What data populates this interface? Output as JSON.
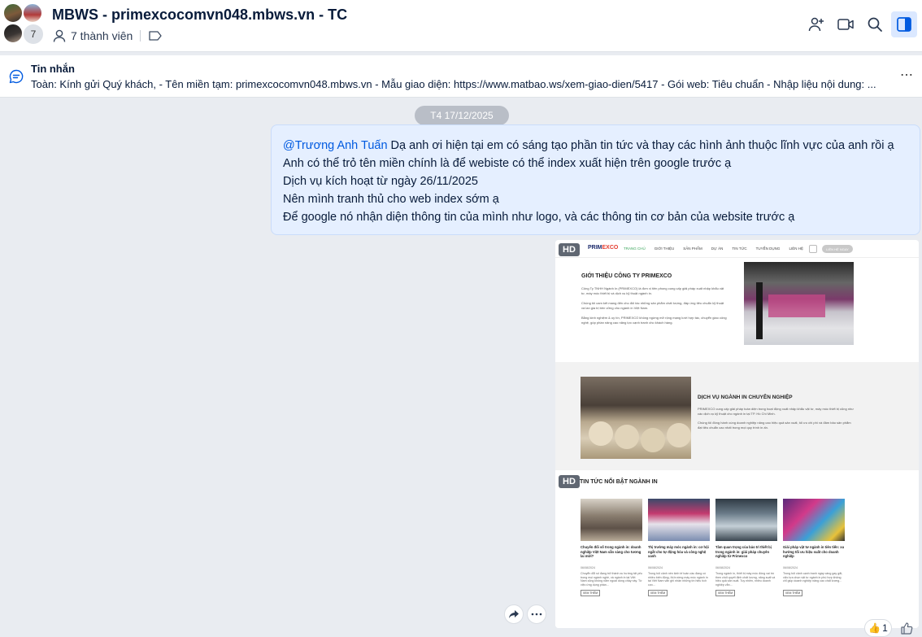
{
  "header": {
    "title": "MBWS - primexcocomvn048.mbws.vn - TC",
    "member_count_badge": "7",
    "members_label": "7 thành viên"
  },
  "pinned": {
    "title": "Tin nhắn",
    "text": "Toàn: Kính gửi Quý khách, - Tên miền tạm: primexcocomvn048.mbws.vn - Mẫu giao diện: https://www.matbao.ws/xem-giao-dien/5417 - Gói web: Tiêu chuẩn - Nhập liệu nội dung: ..."
  },
  "date_separator": "T4 17/12/2025",
  "message": {
    "mention": "@Trương Anh Tuấn",
    "line1": " Dạ anh ơi hiện tại em có sáng tạo phần tin tức và thay các hình ảnh thuộc lĩnh vực của anh rồi ạ",
    "line2": "Anh có thể trỏ tên miền chính là để webiste có thể index xuất hiện trên google trước ạ",
    "line3": "Dịch vụ kích hoạt từ ngày 26/11/2025",
    "line4": "Nên mình tranh thủ cho web index sớm ạ",
    "line5": "Để google nó nhận diện thông tin của mình như logo, và các thông tin cơ bản của website trước ạ"
  },
  "image_message": {
    "hd_label": "HD",
    "site": {
      "logo_main": "PRIM",
      "logo_accent": "EXCO",
      "menu": [
        "TRANG CHỦ",
        "GIỚI THIỆU",
        "SẢN PHẨM",
        "DỰ ÁN",
        "TIN TỨC",
        "TUYỂN DỤNG",
        "LIÊN HỆ"
      ],
      "cta": "LIÊN HỆ NGAY",
      "intro_title": "GIỚI THIỆU CÔNG TY PRIMEXCO",
      "intro_p1": "Công Ty TNHH Ngành In (PRIMEXCO) là đơn vị tiên phong cung cấp giải pháp xuất nhập khẩu vật tư, máy móc thiết bị và dịch vụ kỹ thuật ngành in.",
      "intro_p2": "Chúng tôi cam kết mang đến cho đối tác những sản phẩm chất lượng, đáp ứng tiêu chuẩn kỹ thuật và lan gia trị bền vững cho ngành in Việt Nam.",
      "intro_p3": "Bằng kinh nghiệm & uy tín, PRIMEXCO không ngừng mở rộng mạng lưới hợp tác, chuyển giao công nghệ, góp phần nâng cao năng lực cạnh tranh cho khách hàng.",
      "service_title": "DỊCH VỤ NGÀNH IN CHUYÊN NGHIỆP",
      "service_p1": "PRIMEXCO cung cấp giải pháp toàn diện trong hoạt động xuất nhập khẩu vật tư, máy móc thiết bị cũng như các dịch vụ kỹ thuật cho ngành in tại TP. Hồ Chí Minh.",
      "service_p2": "Chúng tôi đồng hành cùng doanh nghiệp nâng cao hiệu quả sản xuất, tối ưu chi phí và đảm bảo sản phẩm đạt tiêu chuẩn cao nhất trong mọi quy trình in ấn.",
      "news_title": "TIN TỨC NỔI BẬT NGÀNH IN",
      "news": [
        {
          "title": "Chuyển đổi số trong ngành in: doanh nghiệp Việt Nam sẵn sàng cho tương lai mới?",
          "date": "06/08/2024",
          "desc": "Chuyển đổi số đang trở thành xu hướng tất yếu trong mọi ngành nghề, và ngành in tại Việt Nam cũng không nằm ngoài dòng chảy này. Từ việc ứng dụng phần...",
          "button": "XEM THÊM"
        },
        {
          "title": "Thị trường máy móc ngành in: cơ hội ngắt cho tự động hóa và công nghệ xanh",
          "date": "06/08/2024",
          "desc": "Trong bối cảnh nền kinh tế toàn cầu đang có nhiều biến động, thị trường máy móc ngành in tại Việt Nam vẫn ghi nhận những tín hiệu tích cực...",
          "button": "XEM THÊM"
        },
        {
          "title": "Tầm quan trọng của bảo trì thiết bị trong ngành in: giải pháp chuyên nghiệp từ Primexco",
          "date": "06/08/2024",
          "desc": "Trong ngành in, thiết bị máy móc đóng vai trò then chốt quyết định chất lượng, năng suất và hiệu quả sản xuất. Tuy nhiên, nhiều doanh nghiệp vẫn...",
          "button": "XEM THÊM"
        },
        {
          "title": "Giải pháp vật tư ngành in tiên tiến: xu hướng tối ưu hiệu suất cho doanh nghiệp",
          "date": "06/08/2024",
          "desc": "Trong bối cảnh cạnh tranh ngày càng gay gắt, việc lựa chọn vật tư ngành in phù hợp không chỉ giúp doanh nghiệp nâng cao chất lượng...",
          "button": "XEM THÊM"
        }
      ]
    }
  },
  "reaction": {
    "emoji": "👍",
    "count": "1"
  },
  "colors": {
    "accent": "#005ae0",
    "bubble_bg": "#e5efff",
    "page_bg": "#e9ecf1"
  }
}
